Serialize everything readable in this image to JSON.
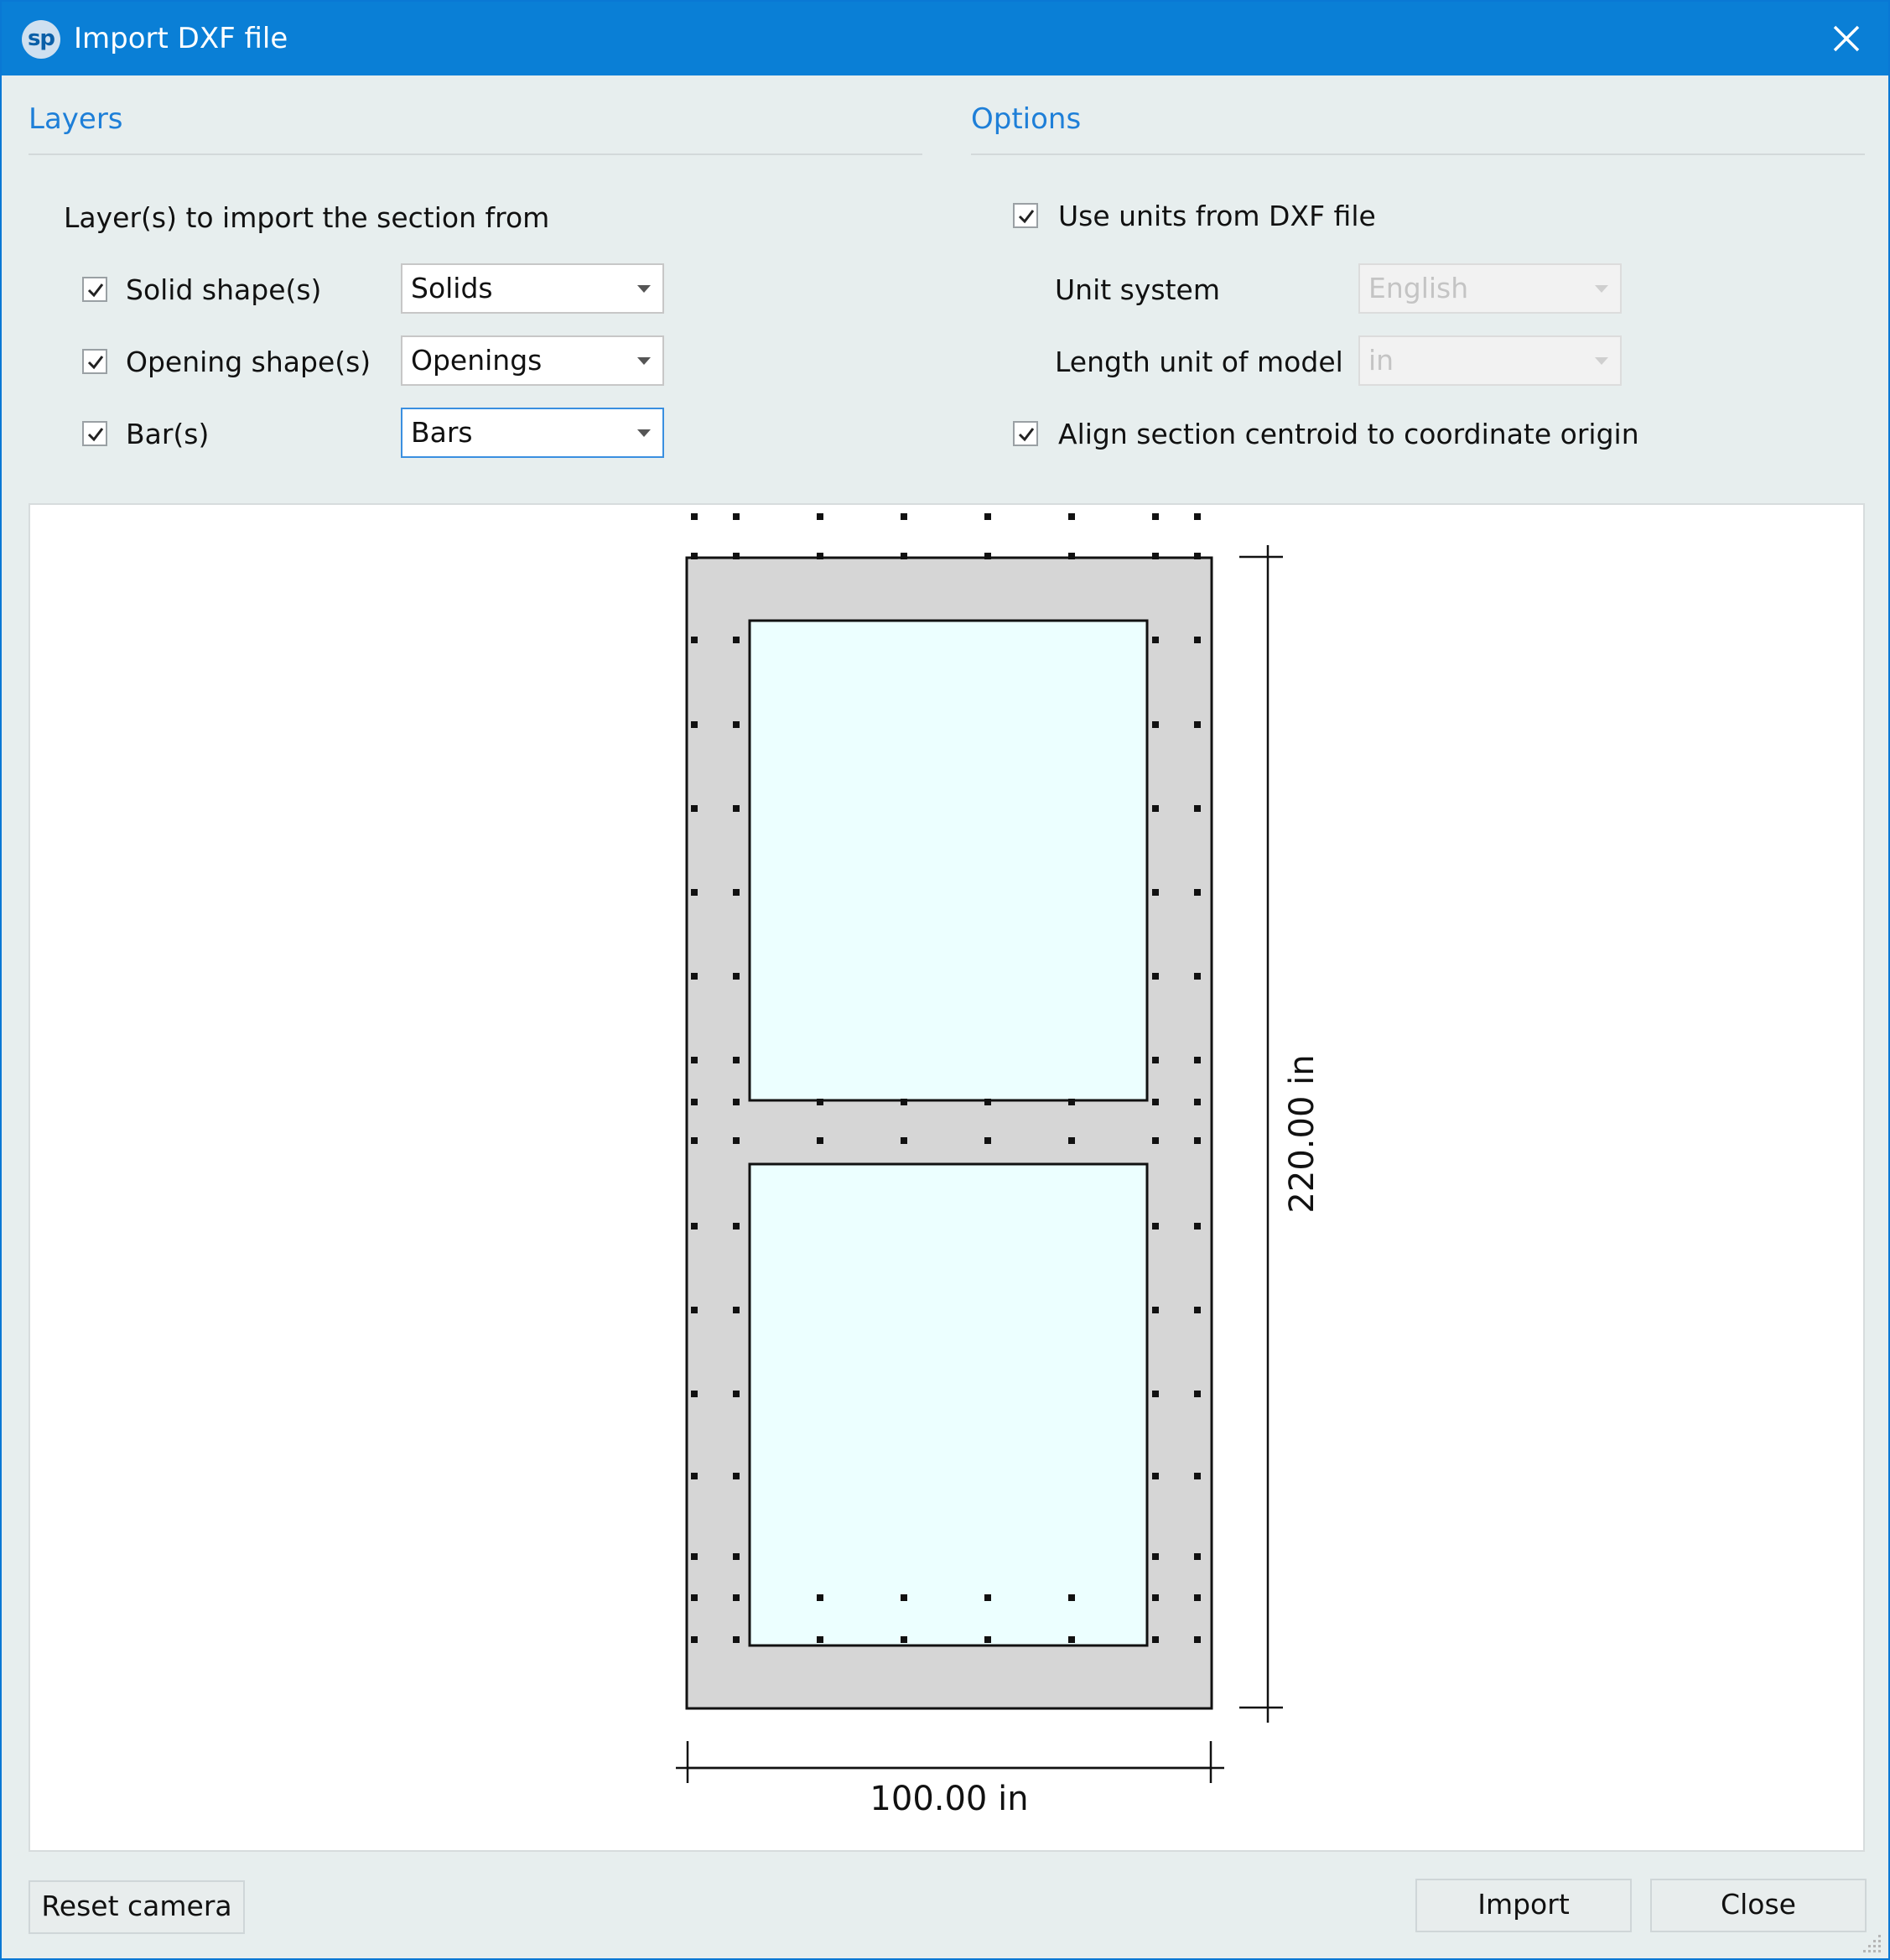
{
  "window": {
    "title": "Import DXF file",
    "logo_text": "sp"
  },
  "layers": {
    "heading": "Layers",
    "intro": "Layer(s) to import the section from",
    "rows": [
      {
        "label": "Solid shape(s)",
        "checked": true,
        "value": "Solids"
      },
      {
        "label": "Opening shape(s)",
        "checked": true,
        "value": "Openings"
      },
      {
        "label": "Bar(s)",
        "checked": true,
        "value": "Bars"
      }
    ]
  },
  "options": {
    "heading": "Options",
    "use_units_label": "Use units from DXF file",
    "use_units_checked": true,
    "unit_system_label": "Unit system",
    "unit_system_value": "English",
    "length_unit_label": "Length unit of model",
    "length_unit_value": "in",
    "align_label": "Align section centroid to coordinate origin",
    "align_checked": true
  },
  "preview": {
    "width_label": "100.00 in",
    "height_label": "220.00 in",
    "colors": {
      "solid": "#d6d6d6",
      "opening": "#ecffff",
      "outline": "#111111"
    }
  },
  "buttons": {
    "reset_camera": "Reset camera",
    "import": "Import",
    "close": "Close"
  },
  "icons": {
    "close": "close-icon",
    "check": "checkmark-icon",
    "dropdown": "chevron-down-icon",
    "resize": "resize-grip-icon"
  }
}
